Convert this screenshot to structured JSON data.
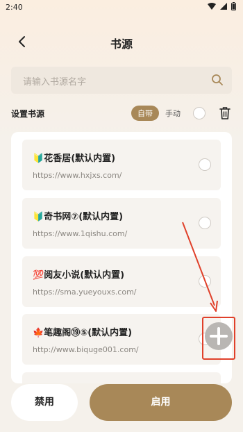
{
  "status": {
    "time": "2:40"
  },
  "header": {
    "title": "书源"
  },
  "search": {
    "placeholder": "请输入书源名字"
  },
  "settings": {
    "label": "设置书源",
    "tab_builtin": "自带",
    "tab_manual": "手动"
  },
  "sources": [
    {
      "emoji": "🔰",
      "name": "花香居(默认内置)",
      "url": "https://www.hxjxs.com/"
    },
    {
      "emoji": "🔰",
      "name": "奇书网⑦(默认内置)",
      "url": "https://www.1qishu.com/"
    },
    {
      "emoji": "💯",
      "name": "阅友小说(默认内置)",
      "url": "https://sma.yueyouxs.com/"
    },
    {
      "emoji": "🍁",
      "name": "笔趣阁⑲⑤(默认内置)",
      "url": "http://www.biquge001.com/"
    }
  ],
  "buttons": {
    "disable": "禁用",
    "enable": "启用"
  },
  "colors": {
    "accent": "#a88858",
    "annotation": "#e0402a"
  }
}
